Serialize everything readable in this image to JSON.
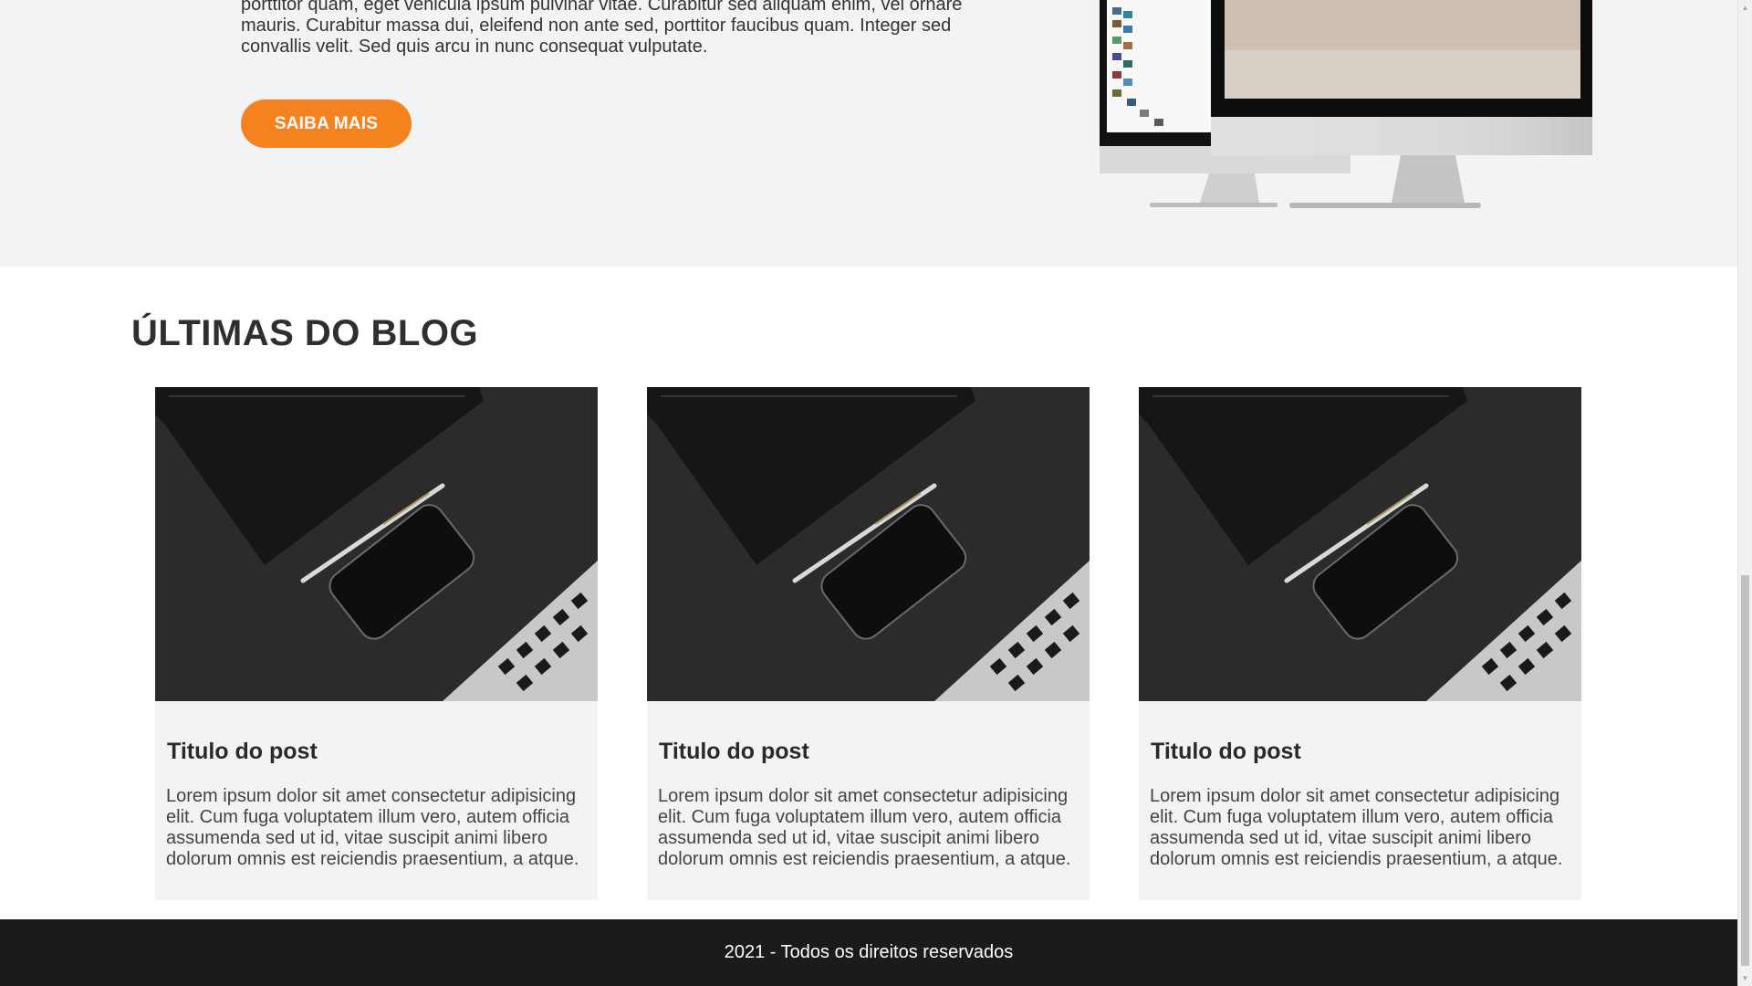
{
  "about": {
    "text": "porttitor quam, eget vehicula ipsum pulvinar vitae. Curabitur sed aliquam enim, vel ornare mauris. Curabitur massa dui, eleifend non ante sed, porttitor faucibus quam. Integer sed convallis velit. Sed quis arcu in nunc consequat vulputate.",
    "button_label": "SAIBA MAIS"
  },
  "blog": {
    "heading": "ÚLTIMAS DO BLOG",
    "posts": [
      {
        "title": "Titulo do post",
        "excerpt": "Lorem ipsum dolor sit amet consectetur adipisicing elit. Cum fuga voluptatem illum vero, autem officia assumenda sed ut id, vitae suscipit animi libero dolorum omnis est reiciendis praesentium, a atque."
      },
      {
        "title": "Titulo do post",
        "excerpt": "Lorem ipsum dolor sit amet consectetur adipisicing elit. Cum fuga voluptatem illum vero, autem officia assumenda sed ut id, vitae suscipit animi libero dolorum omnis est reiciendis praesentium, a atque."
      },
      {
        "title": "Titulo do post",
        "excerpt": "Lorem ipsum dolor sit amet consectetur adipisicing elit. Cum fuga voluptatem illum vero, autem officia assumenda sed ut id, vitae suscipit animi libero dolorum omnis est reiciendis praesentium, a atque."
      }
    ]
  },
  "footer": {
    "text": "2021 - Todos os direitos reservados"
  },
  "colors": {
    "accent": "#f5821f",
    "section_bg": "#f2f3f4",
    "footer_bg": "#1b1b1d"
  },
  "icons": {
    "scroll_up": "triangle-up-icon",
    "scroll_down": "triangle-down-icon"
  }
}
